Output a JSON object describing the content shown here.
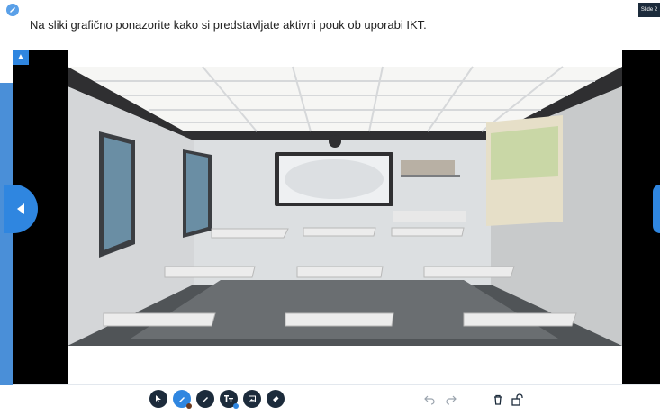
{
  "header": {
    "prompt": "Na sliki grafično ponazorite kako si predstavljate aktivni pouk ob uporabi IKT.",
    "slide_label": "Slide 2"
  },
  "colors": {
    "accent": "#2f86e0",
    "rail": "#4a8fd8",
    "toolbar_icon": "#1c2b3b",
    "pen_dot": "#6b3a1f",
    "text_dot": "#2f86e0"
  },
  "toolbar": {
    "tools": [
      "select-icon",
      "pen-icon",
      "highlighter-icon",
      "text-icon",
      "image-icon",
      "eraser-icon"
    ],
    "utilities": [
      "undo-icon",
      "redo-icon",
      "trash-icon",
      "unlock-icon"
    ]
  }
}
